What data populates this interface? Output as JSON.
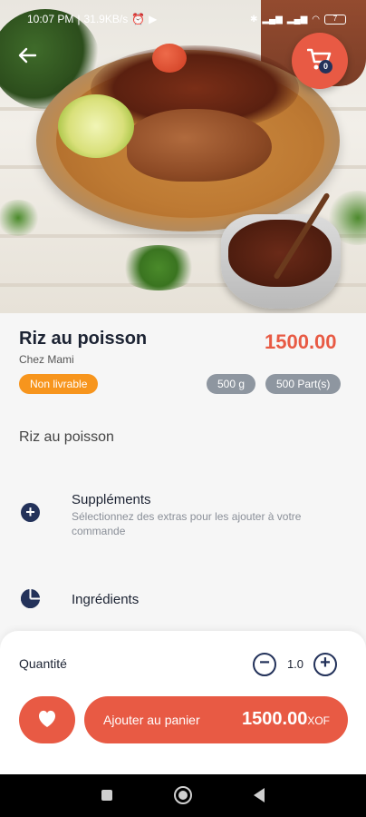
{
  "status_bar": {
    "time": "10:07 PM",
    "speed": "31.9KB/s",
    "battery": "7"
  },
  "header": {
    "back_icon": "arrow-left-icon",
    "cart_icon": "cart-icon",
    "cart_count": "0"
  },
  "product": {
    "name": "Riz au poisson",
    "vendor": "Chez Mami",
    "price": "1500.00",
    "availability_badge": "Non livrable",
    "weight": "500 g",
    "portions": "500 Part(s)",
    "description": "Riz au poisson"
  },
  "sections": {
    "supplements": {
      "icon": "plus-circle-icon",
      "title": "Suppléments",
      "subtitle": "Sélectionnez des extras pour les ajouter à votre commande"
    },
    "ingredients": {
      "icon": "pie-chart-icon",
      "title": "Ingrédients"
    }
  },
  "order": {
    "quantity_label": "Quantité",
    "quantity_value": "1.0",
    "add_to_cart_label": "Ajouter au panier",
    "total": "1500.00",
    "currency": "XOF"
  },
  "colors": {
    "accent": "#e85a44",
    "navy": "#23325a",
    "badge_orange": "#f7951d",
    "pill_gray": "#8e96a0"
  }
}
